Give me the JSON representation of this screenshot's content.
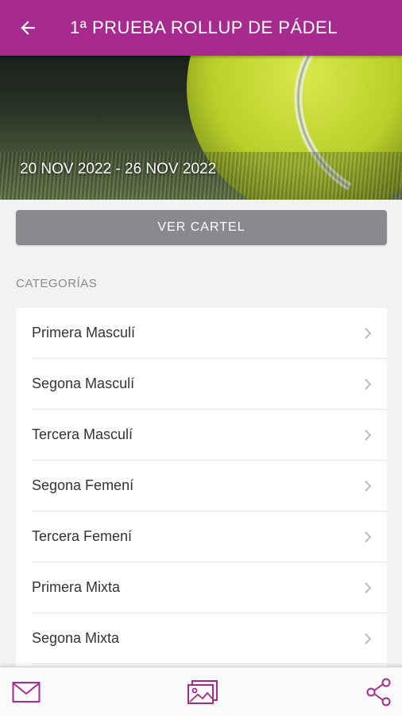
{
  "header": {
    "title": "1ª PRUEBA ROLLUP DE PÁDEL",
    "back_icon": "arrow-left-icon",
    "color": "#a72a8f"
  },
  "hero": {
    "date_range": "20 NOV 2022 - 26 NOV 2022"
  },
  "poster_button": {
    "label": "VER CARTEL"
  },
  "categories": {
    "heading": "CATEGORÍAS",
    "items": [
      {
        "label": "Primera Masculí"
      },
      {
        "label": "Segona Masculí"
      },
      {
        "label": "Tercera Masculí"
      },
      {
        "label": "Segona Femení"
      },
      {
        "label": "Tercera Femení"
      },
      {
        "label": "Primera Mixta"
      },
      {
        "label": "Segona Mixta"
      }
    ]
  },
  "bottom_bar": {
    "icons": [
      "mail-icon",
      "gallery-icon",
      "share-icon"
    ]
  }
}
